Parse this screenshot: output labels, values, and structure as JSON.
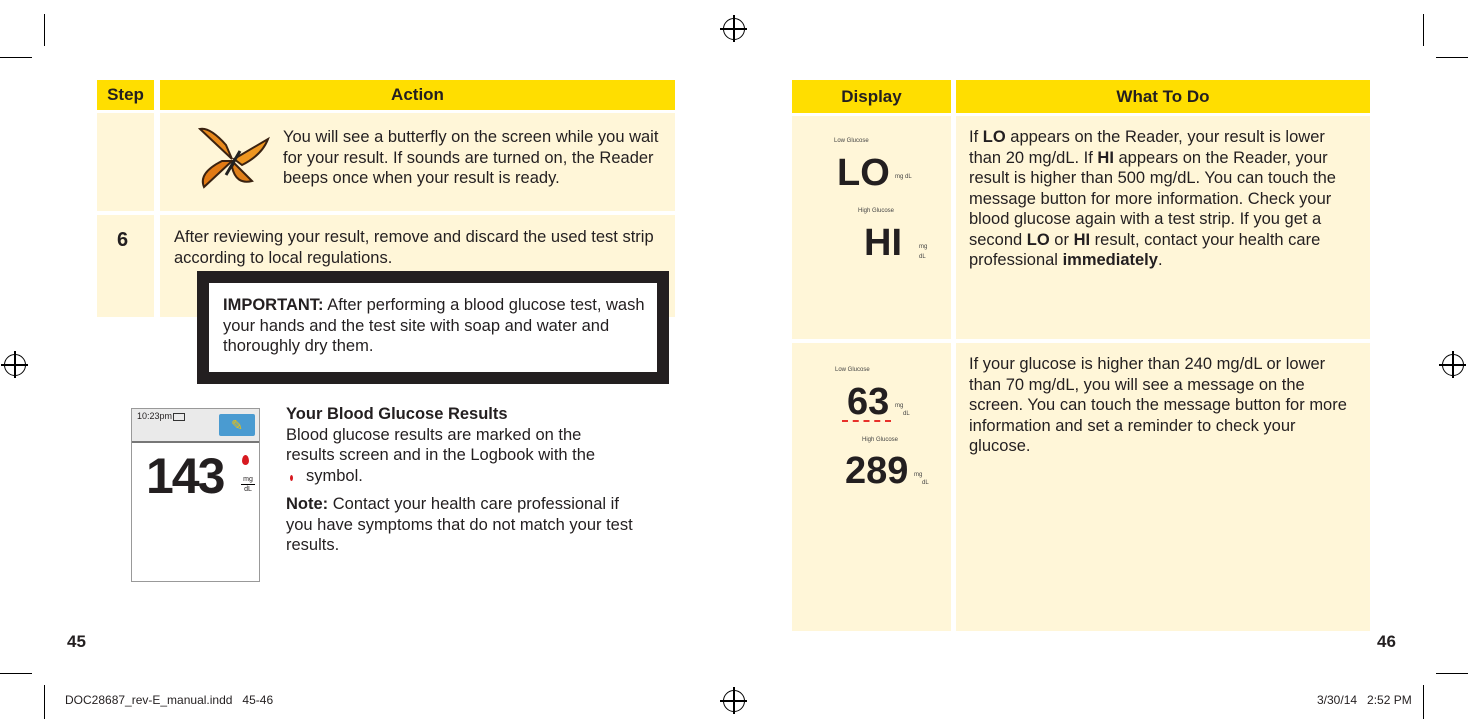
{
  "left_page": {
    "headers": {
      "step": "Step",
      "action": "Action"
    },
    "row1": {
      "text": "You will see a butterfly on the screen while you wait for your result. If sounds are turned on, the Reader beeps once when your result is ready."
    },
    "row2": {
      "step": "6",
      "text": "After reviewing your result, remove and discard the used test strip according to local regulations."
    },
    "important": {
      "label": "IMPORTANT:",
      "text": " After performing a blood glucose test, wash your hands and the test site with soap and water and thoroughly dry them."
    },
    "meter": {
      "time": "10:23pm",
      "value": "143",
      "unit_top": "mg",
      "unit_bottom": "dL"
    },
    "results": {
      "title": "Your Blood Glucose Results",
      "text": "Blood glucose results are marked on the results screen and in the Logbook with the",
      "symbol_text": "symbol.",
      "note_label": "Note:",
      "note_text": " Contact your health care professional if you have symptoms that do not match your test results."
    },
    "page_number": "45"
  },
  "right_page": {
    "headers": {
      "display": "Display",
      "what": "What To Do"
    },
    "row1": {
      "low_label": "Low Glucose",
      "lo": "LO",
      "lo_unit": "mg dL",
      "high_label": "High Glucose",
      "hi": "HI",
      "hi_unit_top": "mg",
      "hi_unit_bottom": "dL",
      "t1": "If ",
      "b1": "LO",
      "t2": " appears on the Reader, your result is lower than 20 mg/dL. If ",
      "b2": "HI",
      "t3": " appears on the Reader, your result is higher than 500 mg/dL. You can touch the message button for more information. Check your blood glucose again with a test strip. If you get a second ",
      "b3": "LO",
      "t4": " or ",
      "b4": "HI",
      "t5": " result, contact your health care professional ",
      "b5": "immediately",
      "t6": "."
    },
    "row2": {
      "low_label": "Low Glucose",
      "low_value": "63",
      "high_label": "High Glucose",
      "high_value": "289",
      "unit_top": "mg",
      "unit_bottom": "dL",
      "text": "If your glucose is higher than 240 mg/dL or lower than 70 mg/dL, you will see a message on the screen. You can touch the message button for more information and set a reminder to check your glucose."
    },
    "page_number": "46"
  },
  "footer": {
    "file": "DOC28687_rev-E_manual.indd   45-46",
    "date": "3/30/14   2:52 PM"
  },
  "colors": {
    "header": "#ffde00",
    "cell": "#fff6d8",
    "drop": "#d71920",
    "button": "#4a9bd1"
  }
}
